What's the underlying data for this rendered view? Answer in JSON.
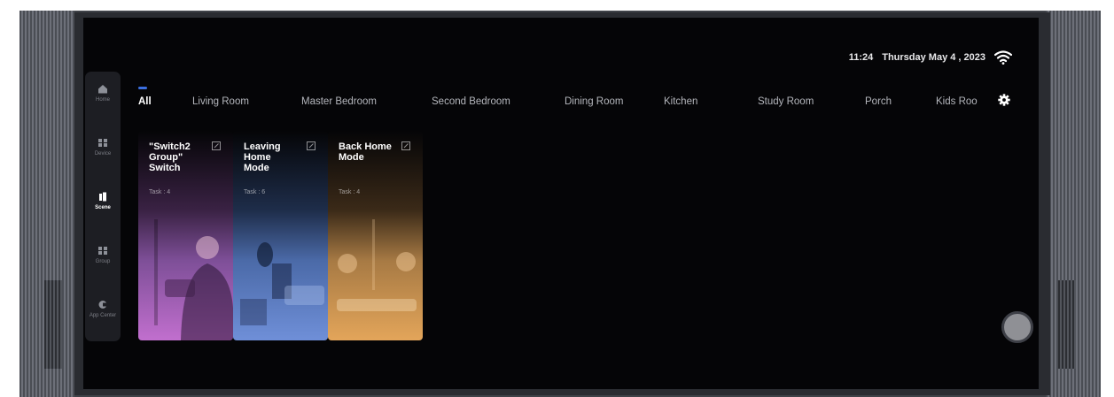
{
  "status": {
    "time": "11:24",
    "date": "Thursday May 4 , 2023",
    "wifi_icon": "wifi-icon"
  },
  "sidebar": {
    "items": [
      {
        "label": "Home",
        "icon": "home-icon"
      },
      {
        "label": "Device",
        "icon": "device-icon"
      },
      {
        "label": "Scene",
        "icon": "scene-icon",
        "active": true
      },
      {
        "label": "Group",
        "icon": "group-icon"
      },
      {
        "label": "App Center",
        "icon": "app-center-icon"
      }
    ]
  },
  "tabs": [
    {
      "label": "All",
      "active": true
    },
    {
      "label": "Living Room"
    },
    {
      "label": "Master Bedroom"
    },
    {
      "label": "Second Bedroom"
    },
    {
      "label": "Dining Room"
    },
    {
      "label": "Kitchen"
    },
    {
      "label": "Study Room"
    },
    {
      "label": "Porch"
    },
    {
      "label": "Kids Roo"
    }
  ],
  "settings_icon": "gear-icon",
  "scenes": [
    {
      "title": "\"Switch2 Group\" Switch",
      "tasks": "Task : 4",
      "accent": "#c16fce"
    },
    {
      "title": "Leaving Home Mode",
      "tasks": "Task : 6",
      "accent": "#6f8fd8"
    },
    {
      "title": "Back Home Mode",
      "tasks": "Task : 4",
      "accent": "#e3a55a"
    }
  ],
  "colors": {
    "screen_bg": "#050507",
    "sidebar_bg": "#1d1e23",
    "tab_indicator": "#3b6fe0"
  }
}
